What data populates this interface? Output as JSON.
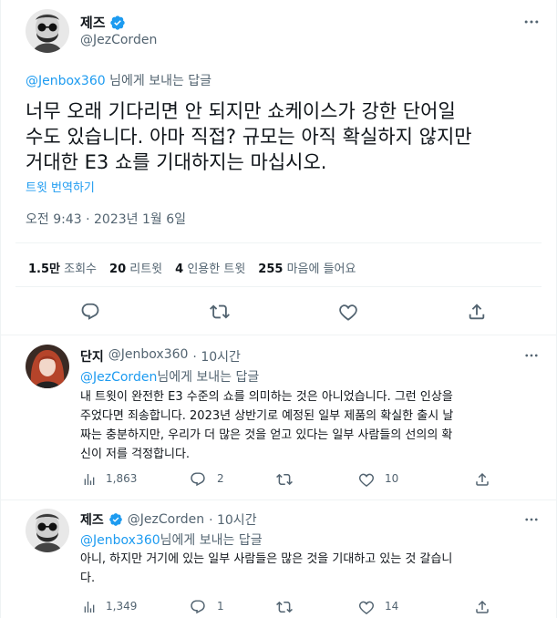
{
  "main_tweet": {
    "author": {
      "name": "제즈",
      "handle": "@JezCorden"
    },
    "reply_to": {
      "mention": "@Jenbox360",
      "suffix": " 님에게 보내는 답글"
    },
    "body_lines": [
      "너무 오래 기다리면 안 되지만 쇼케이스가 강한 단어일",
      "수도 있습니다. 아마 직접? 규모는 아직 확실하지 않지만",
      "거대한 E3 쇼를 기대하지는 마십시오."
    ],
    "translate_label": "트윗 번역하기",
    "timestamp": "오전 9:43 · 2023년 1월 6일",
    "stats": {
      "views_num": "1.5만",
      "views_label": "조회수",
      "retweets_num": "20",
      "retweets_label": "리트윗",
      "quotes_num": "4",
      "quotes_label": "인용한 트윗",
      "likes_num": "255",
      "likes_label": "마음에 들어요"
    }
  },
  "replies": [
    {
      "name": "단지",
      "handle": "@Jenbox360",
      "time": "· 10시간",
      "reply_mention": "@JezCorden",
      "reply_suffix": "님에게 보내는 답글",
      "body_lines": [
        "내 트윗이 완전한 E3 수준의 쇼를 의미하는 것은 아니었습니다. 그런 인상을",
        "주었다면 죄송합니다. 2023년 상반기로 예정된 일부 제품의 확실한 출시 날",
        "짜는 충분하지만, 우리가 더 많은 것을 얻고 있다는 일부 사람들의 선의의 확",
        "신이 저를 걱정합니다."
      ],
      "views": "1,863",
      "replies_count": "2",
      "retweets": "",
      "likes": "10"
    },
    {
      "name": "제즈",
      "handle": "@JezCorden",
      "time": "· 10시간",
      "reply_mention": "@Jenbox360",
      "reply_suffix": "님에게 보내는 답글",
      "body_lines": [
        "아니, 하지만 거기에 있는 일부 사람들은 많은 것을 기대하고 있는 것 갈습니",
        "다."
      ],
      "views": "1,349",
      "replies_count": "1",
      "retweets": "",
      "likes": "14"
    }
  ],
  "icons": {
    "verified": "verified-badge-icon",
    "more": "more-horizontal-icon",
    "reply": "reply-icon",
    "retweet": "retweet-icon",
    "like": "heart-icon",
    "share": "share-icon",
    "views": "analytics-icon"
  },
  "colors": {
    "accent": "#1d9bf0",
    "text": "#0f1419",
    "muted": "#536471",
    "divider": "#eff3f4"
  }
}
